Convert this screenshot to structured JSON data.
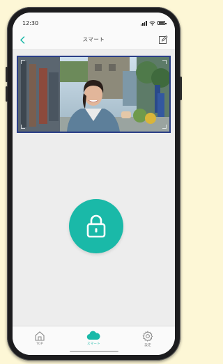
{
  "status_bar": {
    "time": "12:30"
  },
  "nav": {
    "title": "スマート",
    "back_icon": "chevron-left-icon",
    "edit_icon": "edit-icon"
  },
  "camera": {
    "subject": "live-camera-feed"
  },
  "lock_button": {
    "icon": "lock-icon",
    "color": "#1ab9a8"
  },
  "tabs": [
    {
      "label": "TOP",
      "icon": "home-icon",
      "active": false
    },
    {
      "label": "スマート",
      "icon": "cloud-icon",
      "active": true
    },
    {
      "label": "設定",
      "icon": "gear-icon",
      "active": false
    }
  ],
  "colors": {
    "accent": "#1ab9a8",
    "camera_border": "#2a3e88",
    "background": "#ededed"
  }
}
